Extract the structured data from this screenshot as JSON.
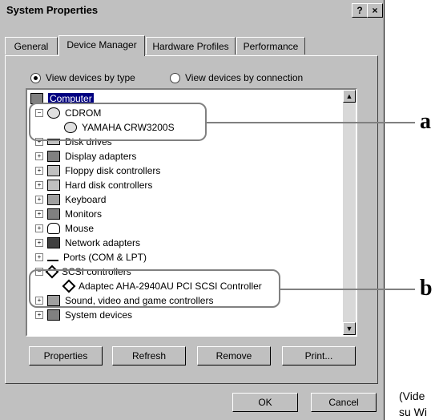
{
  "window": {
    "title": "System Properties",
    "help_label": "?",
    "close_label": "×"
  },
  "tabs": [
    {
      "label": "General"
    },
    {
      "label": "Device Manager"
    },
    {
      "label": "Hardware Profiles"
    },
    {
      "label": "Performance"
    }
  ],
  "radios": {
    "by_type": "View devices by type",
    "by_connection": "View devices by connection",
    "selected": "by_type"
  },
  "tree": {
    "root": "Computer",
    "items": [
      {
        "label": "CDROM",
        "expanded": true
      },
      {
        "label": "YAMAHA CRW3200S",
        "child": true
      },
      {
        "label": "Disk drives"
      },
      {
        "label": "Display adapters"
      },
      {
        "label": "Floppy disk controllers"
      },
      {
        "label": "Hard disk controllers"
      },
      {
        "label": "Keyboard"
      },
      {
        "label": "Monitors"
      },
      {
        "label": "Mouse"
      },
      {
        "label": "Network adapters"
      },
      {
        "label": "Ports (COM & LPT)"
      },
      {
        "label": "SCSI controllers",
        "expanded": true
      },
      {
        "label": "Adaptec AHA-2940AU PCI SCSI Controller",
        "child": true
      },
      {
        "label": "Sound, video and game controllers"
      },
      {
        "label": "System devices"
      }
    ]
  },
  "buttons": {
    "properties": "Properties",
    "refresh": "Refresh",
    "remove": "Remove",
    "print": "Print...",
    "ok": "OK",
    "cancel": "Cancel"
  },
  "callouts": {
    "a": "a",
    "b": "b"
  },
  "side_text": {
    "line1": "(Vide",
    "line2": "su Wi"
  }
}
